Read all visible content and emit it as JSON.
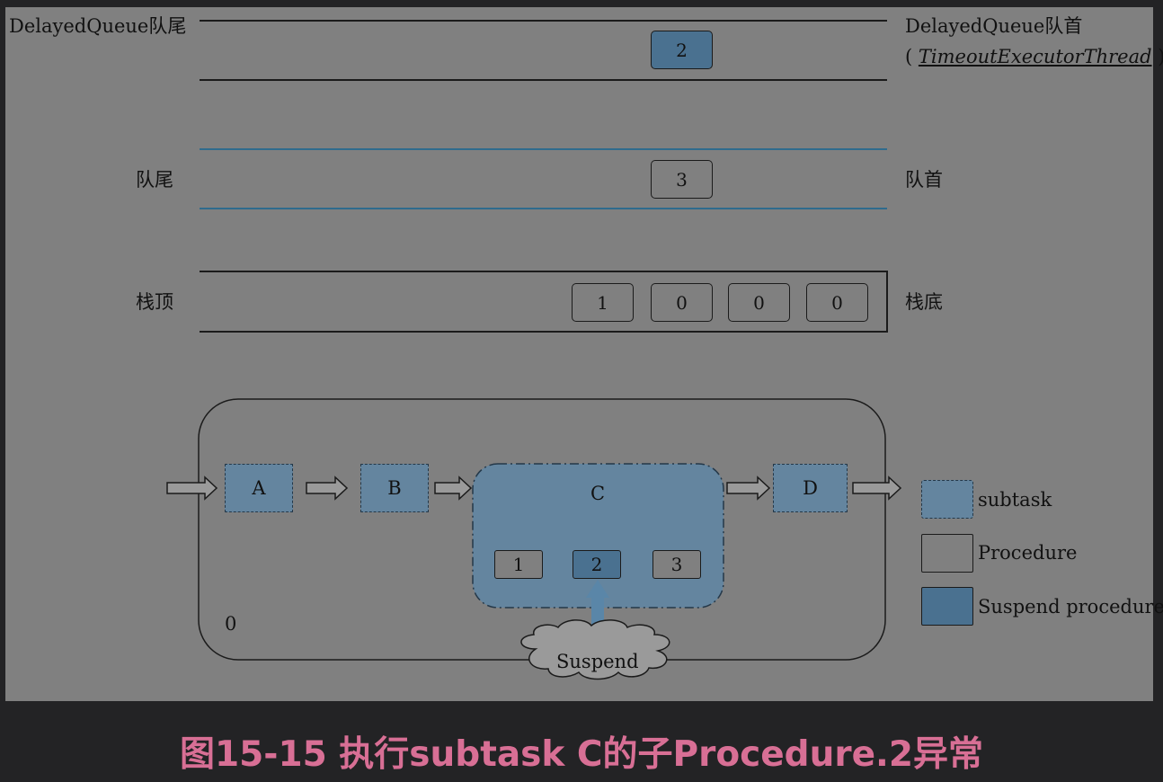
{
  "delayed_queue": {
    "tail_label": "DelayedQueue队尾",
    "head_label": "DelayedQueue队首",
    "head_note_open": "(",
    "head_note_thread": "TimeoutExecutorThread",
    "head_note_close": ")",
    "items": [
      "2"
    ]
  },
  "queue": {
    "tail_label": "队尾",
    "head_label": "队首",
    "items": [
      "3"
    ]
  },
  "stack": {
    "top_label": "栈顶",
    "bottom_label": "栈底",
    "items": [
      "1",
      "0",
      "0",
      "0"
    ]
  },
  "procedure": {
    "id_label": "0",
    "subtasks": [
      "A",
      "B",
      "C",
      "D"
    ],
    "c_children": [
      "1",
      "2",
      "3"
    ],
    "suspend_label": "Suspend"
  },
  "legend": {
    "subtask": "subtask",
    "procedure": "Procedure",
    "suspend_procedure": "Suspend procedure"
  },
  "colors": {
    "figure_background": "#808080",
    "subtask_fill": "#64859f",
    "suspend_fill": "#4a7190",
    "queue_line_blue": "#2f6b8d",
    "caption_pink": "#d86f95"
  },
  "caption": "图15-15 执行subtask C的子Procedure.2异常"
}
